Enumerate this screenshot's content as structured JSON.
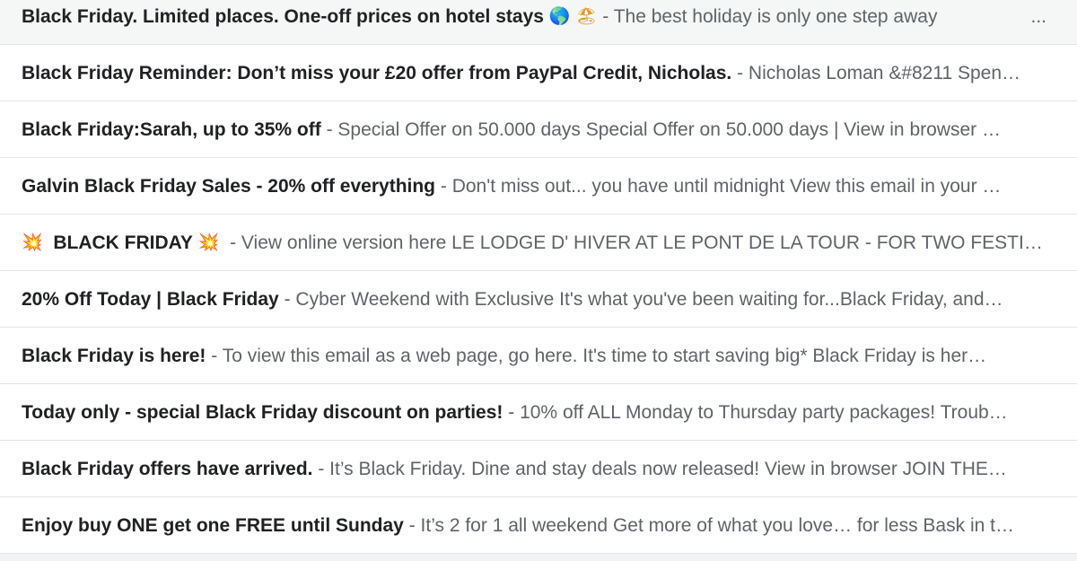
{
  "emails": [
    {
      "subject_pre_icon": "",
      "subject": "Black Friday. Limited places. One-off prices on hotel stays",
      "subject_post_icon": "🌎 🏖",
      "snippet": "The best holiday is only one step away",
      "trailing": "..."
    },
    {
      "subject_pre_icon": "",
      "subject": "Black Friday Reminder: Don’t miss your £20 offer from PayPal Credit, Nicholas.",
      "subject_post_icon": "",
      "snippet": "Nicholas Loman &#8211 Spen…",
      "trailing": ""
    },
    {
      "subject_pre_icon": "",
      "subject": "Black Friday:Sarah, up to 35% off",
      "subject_post_icon": "",
      "snippet": "Special Offer on 50.000 days Special Offer on 50.000 days | View in browser …",
      "trailing": ""
    },
    {
      "subject_pre_icon": "",
      "subject": "Galvin Black Friday Sales - 20% off everything",
      "subject_post_icon": "",
      "snippet": "Don't miss out... you have until midnight View this email in your …",
      "trailing": ""
    },
    {
      "subject_pre_icon": "💥",
      "subject": "BLACK FRIDAY",
      "subject_post_icon": "💥",
      "snippet": "View online version here LE LODGE D' HIVER AT LE PONT DE LA TOUR - FOR TWO FESTI…",
      "trailing": ""
    },
    {
      "subject_pre_icon": "",
      "subject": "20% Off Today | Black Friday",
      "subject_post_icon": "",
      "snippet": "Cyber Weekend with Exclusive It's what you've been waiting for...Black Friday, and…",
      "trailing": ""
    },
    {
      "subject_pre_icon": "",
      "subject": "Black Friday is here!",
      "subject_post_icon": "",
      "snippet": "To view this email as a web page, go here. It's time to start saving big* Black Friday is her…",
      "trailing": ""
    },
    {
      "subject_pre_icon": "",
      "subject": "Today only - special Black Friday discount on parties!",
      "subject_post_icon": "",
      "snippet": "10% off ALL Monday to Thursday party packages! Troub…",
      "trailing": ""
    },
    {
      "subject_pre_icon": "",
      "subject": "Black Friday offers have arrived.",
      "subject_post_icon": "",
      "snippet": "It’s Black Friday. Dine and stay deals now released! View in browser JOIN THE…",
      "trailing": ""
    },
    {
      "subject_pre_icon": "",
      "subject": "Enjoy buy ONE get one FREE until Sunday",
      "subject_post_icon": "",
      "snippet": "It’s 2 for 1 all weekend Get more of what you love… for less Bask in t…",
      "trailing": ""
    }
  ],
  "separator": " - ",
  "icons": {
    "row1_post": [
      "globe-icon",
      "beach-umbrella-icon"
    ],
    "row5_pre": "collision-icon",
    "row5_post": "collision-icon"
  },
  "colors": {
    "subject_text": "#202124",
    "snippet_text": "#5f6368",
    "row_divider": "#e3e4e6"
  }
}
